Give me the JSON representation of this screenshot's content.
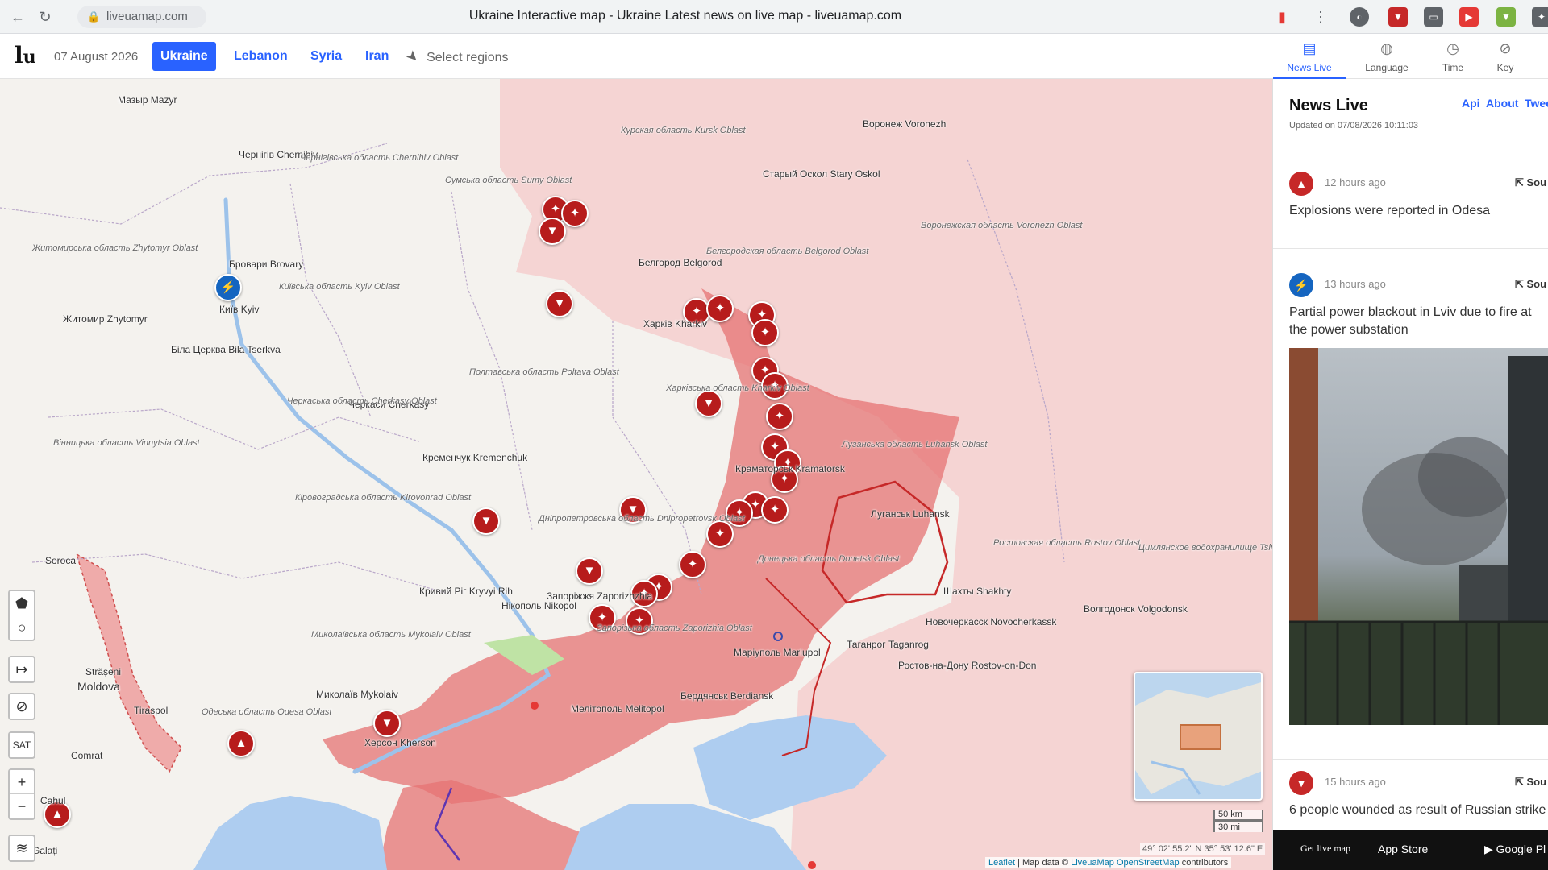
{
  "browser": {
    "url": "liveuamap.com",
    "title": "Ukraine Interactive map - Ukraine Latest news on live map - liveuamap.com"
  },
  "header": {
    "date": "07 August 2026",
    "regions": [
      "Ukraine",
      "Lebanon",
      "Syria",
      "Iran"
    ],
    "active_region": "Ukraine",
    "select_regions": "Select regions",
    "right_tabs": [
      "News Live",
      "Language",
      "Time",
      "Key"
    ]
  },
  "map": {
    "cities": [
      "Мазыр Mazyr",
      "Чернігів Chernihiv",
      "Бровари Brovary",
      "Київ Kyiv",
      "Житомир Zhytomyr",
      "Біла Церква Bila Tserkva",
      "Черкаси Cherkasy",
      "Кременчук Kremenchuk",
      "Харків Kharkiv",
      "Белгород Belgorod",
      "Воронеж Voronezh",
      "Старый Оскол Stary Oskol",
      "Краматорськ Kramatorsk",
      "Луганськ Luhansk",
      "Маріуполь Mariupol",
      "Кривий Ріг Kryvyi Rih",
      "Нікополь Nikopol",
      "Запоріжжя Zaporizhzhia",
      "Миколаїв Mykolaiv",
      "Херсон Kherson",
      "Мелітополь Melitopol",
      "Бердянськ Berdiansk",
      "Таганрог Taganrog",
      "Ростов-на-Дону Rostov-on-Don",
      "Шахты Shakhty",
      "Новочеркасск Novocherkassk",
      "Волгодонск Volgodonsk",
      "Moldova",
      "Tiraspol",
      "Comrat",
      "Cahul",
      "Strășeni",
      "Soroca",
      "Galați"
    ],
    "oblasts": [
      "Курская область Kursk Oblast",
      "Сумська область Sumy Oblast",
      "Чернігівська область Chernihiv Oblast",
      "Київська область Kyiv Oblast",
      "Житомирська область Zhytomyr Oblast",
      "Полтавська область Poltava Oblast",
      "Харківська область Kharkiv Oblast",
      "Черкаська область Cherkasy Oblast",
      "Вінницька область Vinnytsia Oblast",
      "Кіровоградська область Kirovohrad Oblast",
      "Дніпропетровська область Dnipropetrovsk Oblast",
      "Луганська область Luhansk Oblast",
      "Донецька область Donetsk Oblast",
      "Запорізька область Zaporizhia Oblast",
      "Миколаївська область Mykolaiv Oblast",
      "Одеська область Odesa Oblast",
      "Белгородская область Belgorod Oblast",
      "Воронежская область Voronezh Oblast",
      "Ростовская область Rostov Oblast",
      "Цимлянское водохранилище Tsimlyansk Reservoir"
    ],
    "controls": {
      "sat": "SAT",
      "zoom_in": "+",
      "zoom_out": "−"
    },
    "scale": [
      "50 km",
      "30 mi"
    ],
    "coords": "49° 02' 55.2\" N 35° 53' 12.6\" E",
    "attribution": {
      "leaflet": "Leaflet",
      "map_data": "| Map data ©",
      "liveuamap": "LiveuaMap",
      "osm": "OpenStreetMap",
      "contributors": "contributors"
    }
  },
  "news": {
    "title": "News Live",
    "links": [
      "Api",
      "About",
      "Twee"
    ],
    "updated": "Updated on 07/08/2026 10:11:03",
    "items": [
      {
        "time": "12 hours ago",
        "source": "Sou",
        "text": "Explosions were reported in Odesa"
      },
      {
        "time": "13 hours ago",
        "source": "Sou",
        "text": "Partial power blackout in Lviv due to fire at the power substation"
      },
      {
        "time": "15 hours ago",
        "source": "Sou",
        "text": "6 people wounded as result of Russian strike"
      }
    ],
    "footer": {
      "get_live_map": "Get live map",
      "app_store": "App Store",
      "google_play": "Google Pl"
    }
  },
  "colors": {
    "occupied": "#e57373",
    "russia_tint": "#f6c9c9",
    "water": "#aecdf0",
    "marker": "#b71c1c",
    "accent": "#2962ff"
  }
}
